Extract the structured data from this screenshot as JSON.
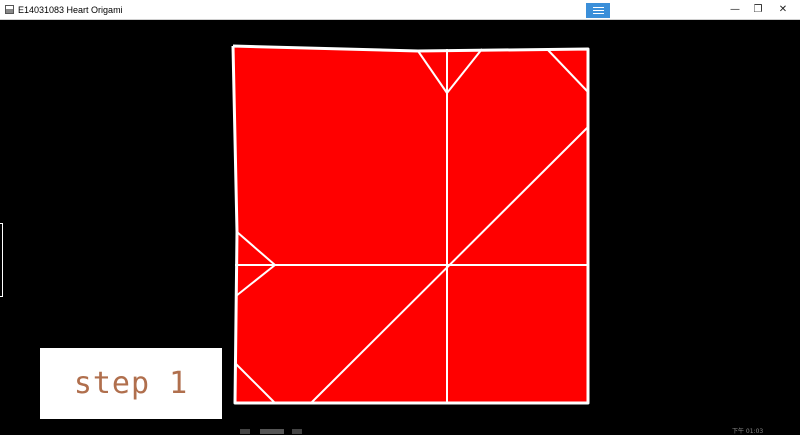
{
  "window": {
    "title": "E14031083 Heart Origami",
    "menu_icon": "hamburger-menu-icon",
    "minimize_glyph": "—",
    "maximize_glyph": "❐",
    "close_glyph": "✕"
  },
  "origami": {
    "paper_color": "#ff0000",
    "fold_line_color": "#ffffff"
  },
  "step_label": "step 1",
  "taskbar": {
    "time": "下午 01:03"
  }
}
